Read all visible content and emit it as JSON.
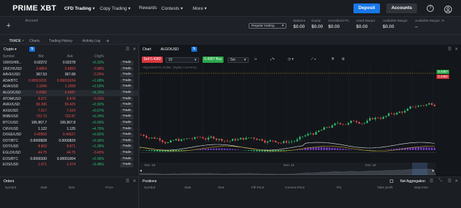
{
  "brand": "PRIME XBT",
  "nav": {
    "cfd_trading": "CFD Trading",
    "copy_trading": "Copy Trading",
    "rewards": "Rewards",
    "contests": "Contests",
    "more": "More",
    "deposit": "Deposit",
    "accounts": "Accounts",
    "help_icon": "?"
  },
  "account": {
    "label": "Account",
    "mode": "Regular trading",
    "stats": [
      {
        "label": "Balance",
        "value": "$0.00"
      },
      {
        "label": "Equity",
        "value": "$0.00"
      },
      {
        "label": "Unrealized PL",
        "value": "$0.00"
      },
      {
        "label": "Used Margin",
        "value": "$0.00"
      },
      {
        "label": "Available Margin",
        "value": "$0.00"
      },
      {
        "label": "Available Margin, %",
        "value": "--"
      }
    ]
  },
  "tabs": [
    "TRADE",
    "Charts",
    "Trading History",
    "Activity Log"
  ],
  "crypto": {
    "title": "Crypto",
    "cols": [
      "Symbol",
      "Bid",
      "Ask",
      "Chg%"
    ],
    "trade_label": "Trade",
    "rows": [
      {
        "s": "1000SHIB...",
        "b": "0.02272",
        "a": "0.02278",
        "c": "+0.33%",
        "bd": "w",
        "ad": "w",
        "cd": "up"
      },
      {
        "s": "1INCH/USD",
        "b": "0.4854",
        "a": "0.4859",
        "c": "-0.88%",
        "bd": "dn",
        "ad": "dn",
        "cd": "dn"
      },
      {
        "s": "AAVE/USD",
        "b": "367.53",
        "a": "367.68",
        "c": "-0.25%",
        "bd": "w",
        "ad": "w",
        "cd": "dn"
      },
      {
        "s": "ADA/BTC",
        "b": "0.00001031",
        "a": "0.00001034",
        "c": "+1.68%",
        "bd": "dn",
        "ad": "dn",
        "cd": "up"
      },
      {
        "s": "ADA/USD",
        "b": "1.1049",
        "a": "1.1058",
        "c": "+2.59%",
        "bd": "dn",
        "ad": "dn",
        "cd": "up"
      },
      {
        "s": "ALGO/USD",
        "b": "0.4382",
        "a": "0.4387",
        "c": "+6.15%",
        "bd": "dn",
        "ad": "dn",
        "cd": "up"
      },
      {
        "s": "ATOM/USD",
        "b": "8.671",
        "a": "8.678",
        "c": "-0.15%",
        "bd": "dn",
        "ad": "dn",
        "cd": "dn"
      },
      {
        "s": "AVAX/USD",
        "b": "50.396",
        "a": "50.425",
        "c": "+2.92%",
        "bd": "dn",
        "ad": "dn",
        "cd": "up"
      },
      {
        "s": "AXS/USD",
        "b": "7.617",
        "a": "7.624",
        "c": "+0.67%",
        "bd": "dn",
        "ad": "dn",
        "cd": "up"
      },
      {
        "s": "BNB/USD",
        "b": "722.73",
        "a": "722.87",
        "c": "+0.24%",
        "bd": "dn",
        "ad": "dn",
        "cd": "up"
      },
      {
        "s": "BTC/USD",
        "b": "106,967.7",
        "a": "106,967.8",
        "c": "+0.99%",
        "bd": "w",
        "ad": "w",
        "cd": "up"
      },
      {
        "s": "CRV/USD",
        "b": "1.122",
        "a": "1.125",
        "c": "+4.76%",
        "bd": "w",
        "ad": "w",
        "cd": "up"
      },
      {
        "s": "DOGE/USD",
        "b": "0.40500",
        "a": "0.40527",
        "c": "+0.82%",
        "bd": "dn",
        "ad": "dn",
        "cd": "up"
      },
      {
        "s": "DOT/BTC",
        "b": "0.0000828",
        "a": "0.0000829",
        "c": "+0.36%",
        "bd": "w",
        "ad": "w",
        "cd": "up"
      },
      {
        "s": "DOT/USD",
        "b": "8.863",
        "a": "8.871",
        "c": "+1.28%",
        "bd": "dn",
        "ad": "dn",
        "cd": "up"
      },
      {
        "s": "EGLD/USD",
        "b": "44.75",
        "a": "44.75",
        "c": "-0.42%",
        "bd": "dn",
        "ad": "dn",
        "cd": "dn"
      },
      {
        "s": "EOS/BTC",
        "b": "0.0000100",
        "a": "0.00001004",
        "c": "+2.56%",
        "bd": "w",
        "ad": "w",
        "cd": "up"
      },
      {
        "s": "EOS/USD",
        "b": "1.071",
        "a": "1.074",
        "c": "+3.48%",
        "bd": "dn",
        "ad": "dn",
        "cd": "up"
      }
    ]
  },
  "orders": {
    "title": "Orders",
    "cols": [
      "Symbol",
      "Side",
      "Size",
      "Price"
    ]
  },
  "chart": {
    "tab": "Chart",
    "symbol": "ALGO/USD",
    "sell": "Sell 0.4382",
    "buy": "0.4387 Buy",
    "qty": "10",
    "interval": "5m",
    "legend": "Algorand/US Dollar, Digital Currency",
    "price_tag_green": "0.4387",
    "price_tag_red": "0.4382",
    "date_labels": [
      "Dec 16",
      "Dec 16",
      "Dec 16"
    ],
    "colors": {
      "up": "#2fbf71",
      "down": "#ef4f4f",
      "buy": "#2aa84a",
      "sell": "#d9363e",
      "accent": "#1877e6"
    }
  },
  "positions": {
    "title": "Positions",
    "net_aggregation": "Net Aggregation",
    "cols": [
      "Symbol",
      "Side",
      "Size",
      "Fill Price",
      "Current Price",
      "P/L",
      "Take profit",
      "Stop loss"
    ]
  }
}
